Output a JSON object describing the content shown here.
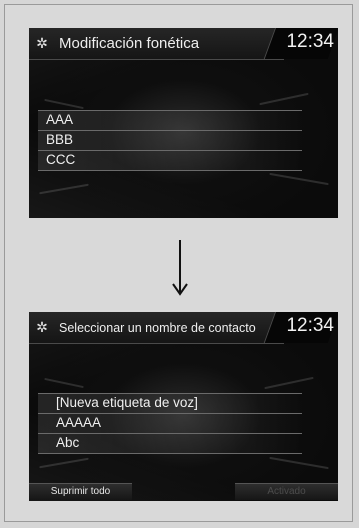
{
  "screen1": {
    "title": "Modificación fonética",
    "clock": "12:34",
    "items": [
      "AAA",
      "BBB",
      "CCC"
    ]
  },
  "screen2": {
    "title": "Seleccionar un nombre de contacto",
    "clock": "12:34",
    "items": [
      "[Nueva etiqueta de voz]",
      "AAAAA",
      "Abc"
    ],
    "softkeys": {
      "left": "Suprimir todo",
      "right": "Activado"
    }
  },
  "icons": {
    "settings": "gear-icon",
    "transition": "arrow-down-icon"
  }
}
